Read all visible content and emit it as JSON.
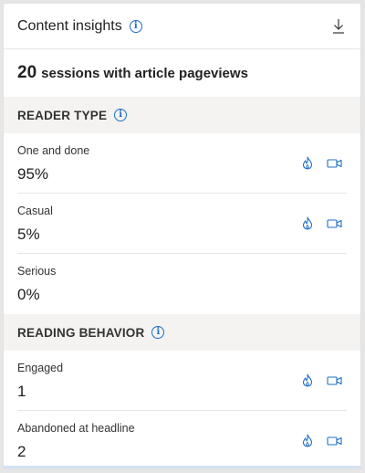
{
  "header": {
    "title": "Content insights",
    "info_icon": "info-icon",
    "download_icon": "download-icon"
  },
  "summary": {
    "count": "20",
    "text": "sessions with article pageviews"
  },
  "sections": [
    {
      "title": "READER TYPE",
      "rows": [
        {
          "label": "One and done",
          "value": "95%",
          "actions": true
        },
        {
          "label": "Casual",
          "value": "5%",
          "actions": true
        },
        {
          "label": "Serious",
          "value": "0%",
          "actions": false
        }
      ]
    },
    {
      "title": "READING BEHAVIOR",
      "rows": [
        {
          "label": "Engaged",
          "value": "1",
          "actions": true
        },
        {
          "label": "Abandoned at headline",
          "value": "2",
          "actions": true
        }
      ]
    }
  ],
  "colors": {
    "accent": "#1f6fc4",
    "section_bg": "#f4f3f1"
  },
  "icons": {
    "heatmap": "flame-icon",
    "recording": "video-camera-icon"
  }
}
